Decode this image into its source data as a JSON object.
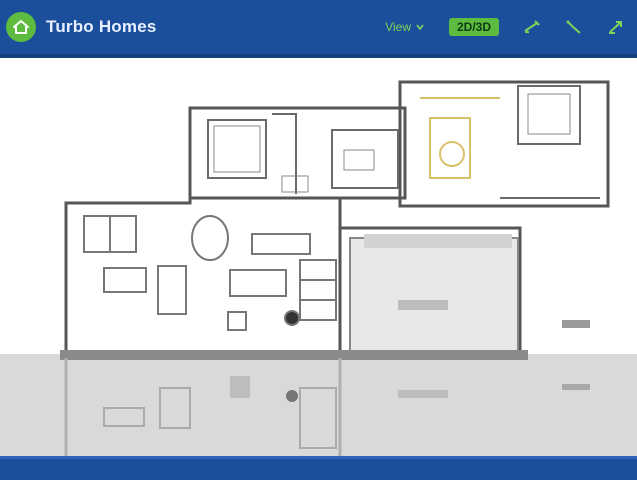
{
  "app": {
    "title": "Turbo Homes"
  },
  "toolbar": {
    "items": [
      {
        "label": "View",
        "icon": "chevron-down-icon"
      },
      {
        "label": "2D/3D",
        "icon": ""
      },
      {
        "label": "",
        "icon": "measure-icon"
      },
      {
        "label": "",
        "icon": "pencil-icon"
      },
      {
        "label": "",
        "icon": "share-icon"
      }
    ]
  },
  "colors": {
    "header": "#1b4f9c",
    "accent": "#5dbb3f",
    "wall": "#555555"
  }
}
